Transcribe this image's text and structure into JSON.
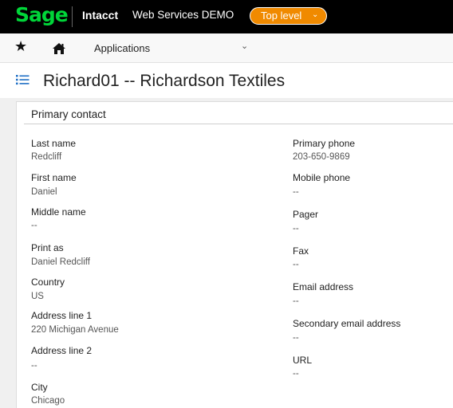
{
  "topbar": {
    "logo": "Sage",
    "product": "Intacct",
    "company": "Web Services DEMO",
    "entity_button": "Top level",
    "entity_chevron": "⌄"
  },
  "navbar": {
    "star_icon": "★",
    "home_icon": "home-icon",
    "applications_label": "Applications",
    "applications_chevron": "⌄"
  },
  "page": {
    "list_icon": "list-icon",
    "title": "Richard01 -- Richardson Textiles"
  },
  "section": {
    "title": "Primary contact"
  },
  "left_fields": [
    {
      "label": "Last name",
      "value": "Redcliff"
    },
    {
      "label": "First name",
      "value": "Daniel"
    },
    {
      "label": "Middle name",
      "value": "--"
    },
    {
      "label": "Print as",
      "value": "Daniel Redcliff"
    },
    {
      "label": "Country",
      "value": "US"
    },
    {
      "label": "Address line 1",
      "value": "220 Michigan Avenue"
    },
    {
      "label": "Address line 2",
      "value": "--"
    },
    {
      "label": "City",
      "value": "Chicago"
    }
  ],
  "right_fields": [
    {
      "label": "Primary phone",
      "value": "203-650-9869"
    },
    {
      "label": "Mobile phone",
      "value": "--"
    },
    {
      "label": "Pager",
      "value": "--"
    },
    {
      "label": "Fax",
      "value": "--"
    },
    {
      "label": "Email address",
      "value": "--"
    },
    {
      "label": "Secondary email address",
      "value": "--"
    },
    {
      "label": "URL",
      "value": "--"
    }
  ],
  "colors": {
    "brand_green": "#00d639",
    "entity_orange": "#f08a00",
    "list_icon_blue": "#1f6fc5"
  }
}
